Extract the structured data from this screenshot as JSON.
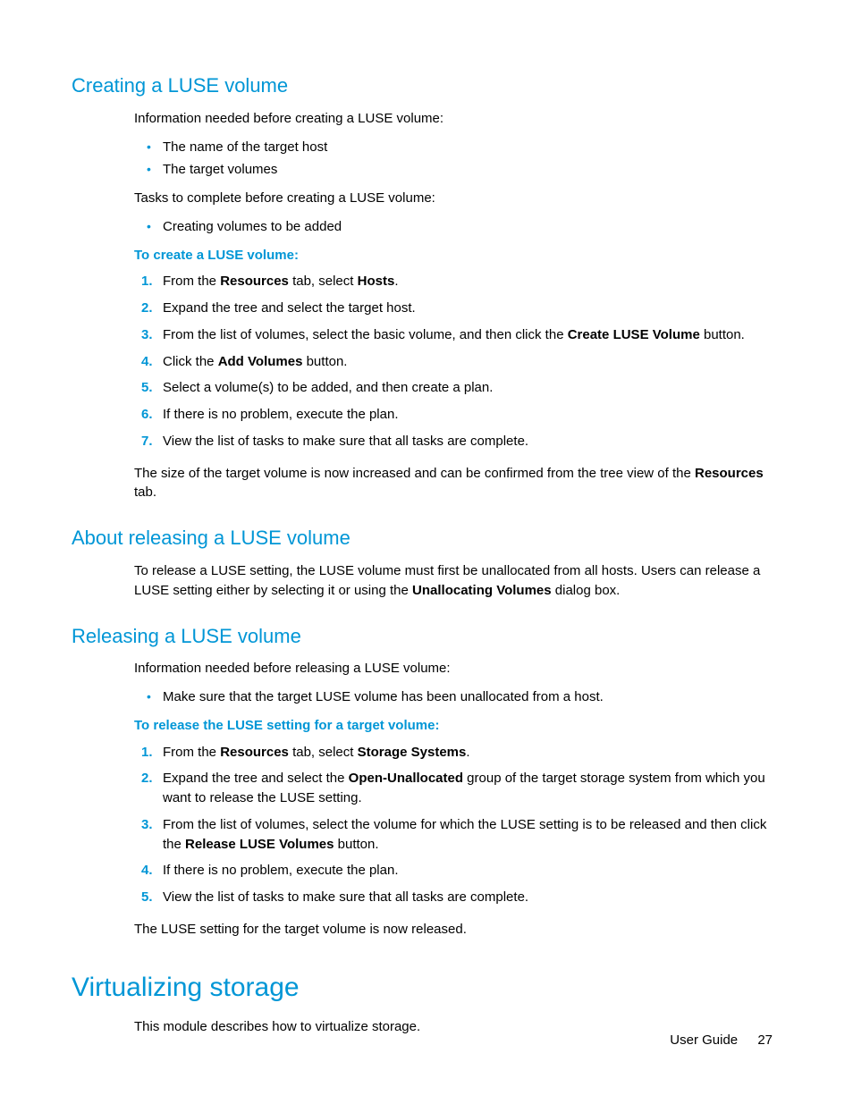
{
  "sec1": {
    "heading": "Creating a LUSE volume",
    "intro1": "Information needed before creating a LUSE volume:",
    "bullets1": [
      "The name of the target host",
      "The target volumes"
    ],
    "intro2": "Tasks to complete before creating a LUSE volume:",
    "bullets2": [
      "Creating volumes to be added"
    ],
    "procTitle": "To create a LUSE volume:",
    "steps": [
      {
        "pre": "From the ",
        "b1": "Resources",
        "mid": " tab, select ",
        "b2": "Hosts",
        "post": "."
      },
      {
        "text": "Expand the tree and select the target host."
      },
      {
        "pre": "From the list of volumes, select the basic volume, and then click the ",
        "b1": "Create LUSE Volume",
        "post": " button."
      },
      {
        "pre": "Click the ",
        "b1": "Add Volumes",
        "post": " button."
      },
      {
        "text": "Select a volume(s) to be added, and then create a plan."
      },
      {
        "text": "If there is no problem, execute the plan."
      },
      {
        "text": "View the list of tasks to make sure that all tasks are complete."
      }
    ],
    "resultPre": "The size of the target volume is now increased and can be confirmed from the tree view of the ",
    "resultBold": "Resources",
    "resultPost": " tab."
  },
  "sec2": {
    "heading": "About releasing a LUSE volume",
    "paraPre": "To release a LUSE setting, the LUSE volume must first be unallocated from all hosts. Users can release a LUSE setting either by selecting it or using the ",
    "paraBold": "Unallocating Volumes",
    "paraPost": " dialog box."
  },
  "sec3": {
    "heading": "Releasing a LUSE volume",
    "intro": "Information needed before releasing a LUSE volume:",
    "bullets": [
      "Make sure that the target LUSE volume has been unallocated from a host."
    ],
    "procTitle": "To release the LUSE setting for a target volume:",
    "steps": [
      {
        "pre": "From the ",
        "b1": "Resources",
        "mid": " tab, select ",
        "b2": "Storage Systems",
        "post": "."
      },
      {
        "pre": "Expand the tree and select the ",
        "b1": "Open-Unallocated",
        "post": " group of the target storage system from which you want to release the LUSE setting."
      },
      {
        "pre": "From the list of volumes, select the volume for which the LUSE setting is to be released and then click the ",
        "b1": "Release LUSE Volumes",
        "post": " button."
      },
      {
        "text": "If there is no problem, execute the plan."
      },
      {
        "text": "View the list of tasks to make sure that all tasks are complete."
      }
    ],
    "result": "The LUSE setting for the target volume is now released."
  },
  "sec4": {
    "heading": "Virtualizing storage",
    "para": "This module describes how to virtualize storage."
  },
  "footer": {
    "label": "User Guide",
    "page": "27"
  }
}
